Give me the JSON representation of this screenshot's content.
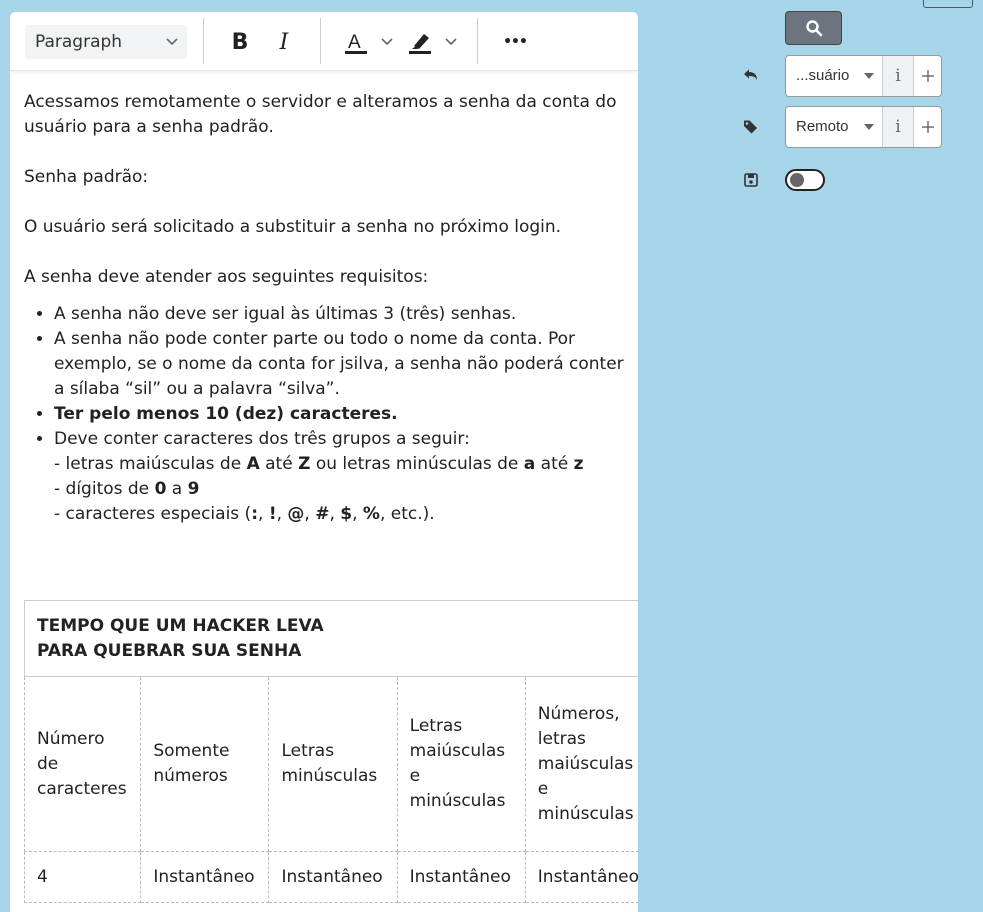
{
  "toolbar": {
    "paragraph_style": "Paragraph",
    "bold_label": "B",
    "italic_label": "I",
    "more_label": "•••"
  },
  "content": {
    "p1": "Acessamos remotamente o servidor e alteramos a senha da conta do usuário para a senha padrão.",
    "p2": "Senha padrão:",
    "p3": "O usuário será solicitado a substituir a senha no próximo login.",
    "p4": "A senha deve atender aos seguintes requisitos:",
    "li1": "A senha não deve ser igual às últimas 3 (três) senhas.",
    "li2": "A senha não pode conter parte ou todo o nome da conta. Por exemplo, se o nome da conta for jsilva, a senha não poderá conter a sílaba “sil” ou a palavra “silva”.",
    "li3": "Ter pelo menos 10 (dez) caracteres.",
    "li4_intro": "Deve conter caracteres dos três grupos a seguir:",
    "li4_a_pre": "- letras maiúsculas de ",
    "li4_a_A": "A",
    "li4_a_ate1": " até ",
    "li4_a_Z": "Z",
    "li4_a_mid": " ou letras minúsculas de ",
    "li4_a_a": "a",
    "li4_a_ate2": " até ",
    "li4_a_z": "z",
    "li4_b_pre": "- dígitos de ",
    "li4_b_0": "0",
    "li4_b_a": " a ",
    "li4_b_9": "9",
    "li4_c_pre": "- caracteres especiais (",
    "li4_c_chars": [
      ":",
      "!",
      "@",
      "#",
      "$",
      "%"
    ],
    "li4_c_sep": ", ",
    "li4_c_end": ", etc.)."
  },
  "table": {
    "title_line1": "TEMPO QUE UM HACKER LEVA",
    "title_line2": "PARA QUEBRAR SUA SENHA",
    "headers": [
      [
        "Número",
        "de",
        "caracteres"
      ],
      [
        "Somente",
        "números"
      ],
      [
        "Letras",
        "minúsculas"
      ],
      [
        "Letras",
        "maiúsculas",
        "e",
        "minúsculas"
      ],
      [
        "Números,",
        "letras",
        "maiúsculas",
        "e",
        "minúsculas"
      ]
    ],
    "rows": [
      [
        "4",
        "Instantâneo",
        "Instantâneo",
        "Instantâneo",
        "Instantâneo"
      ]
    ]
  },
  "sidebar": {
    "requester_select": "...suário",
    "tag_select": "Remoto",
    "info_label": "i",
    "plus_label": "+"
  },
  "icons": {
    "search": "search-icon",
    "reply": "reply-icon",
    "tag": "tag-icon",
    "save": "save-icon"
  },
  "colors": {
    "background": "#a6d5ea",
    "search_button": "#6c757d"
  }
}
